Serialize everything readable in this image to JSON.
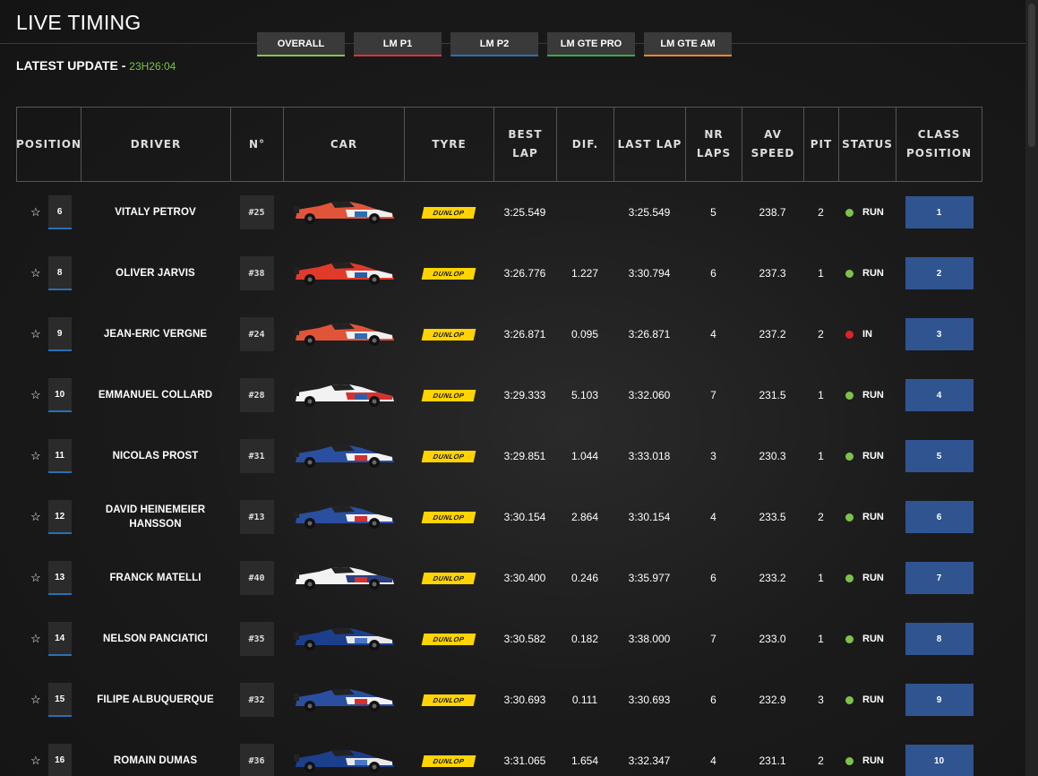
{
  "page": {
    "title": "LIVE TIMING",
    "update_label": "LATEST UPDATE - ",
    "update_time": "23H26:04"
  },
  "tabs": [
    {
      "label": "OVERALL",
      "color": "#8bc34a"
    },
    {
      "label": "LM P1",
      "color": "#e0323a"
    },
    {
      "label": "LM P2",
      "color": "#2a6fb4"
    },
    {
      "label": "LM GTE PRO",
      "color": "#39a84a"
    },
    {
      "label": "LM GTE AM",
      "color": "#f08a2c"
    }
  ],
  "columns": [
    "POSITION",
    "DRIVER",
    "N°",
    "CAR",
    "TYRE",
    "BEST\nLAP",
    "DIF.",
    "LAST LAP",
    "NR\nLAPS",
    "AV\nSPEED",
    "PIT",
    "STATUS",
    "CLASS\nPOSITION"
  ],
  "tyre_brand": "DUNLOP",
  "status_colors": {
    "RUN": "#7cc24a",
    "IN": "#e02424"
  },
  "rows": [
    {
      "position": "6",
      "driver": "VITALY PETROV",
      "number": "#25",
      "livery": [
        "#e0553a",
        "#f0f0f0",
        "#2a6fb4"
      ],
      "best_lap": "3:25.549",
      "dif": "",
      "last_lap": "3:25.549",
      "laps": "5",
      "speed": "238.7",
      "pit": "2",
      "status": "RUN",
      "class_pos": "1"
    },
    {
      "position": "8",
      "driver": "OLIVER JARVIS",
      "number": "#38",
      "livery": [
        "#e03a2a",
        "#f0f0f0",
        "#2a5ea8"
      ],
      "best_lap": "3:26.776",
      "dif": "1.227",
      "last_lap": "3:30.794",
      "laps": "6",
      "speed": "237.3",
      "pit": "1",
      "status": "RUN",
      "class_pos": "2"
    },
    {
      "position": "9",
      "driver": "JEAN-ERIC VERGNE",
      "number": "#24",
      "livery": [
        "#e0553a",
        "#f0f0f0",
        "#2a6fb4"
      ],
      "best_lap": "3:26.871",
      "dif": "0.095",
      "last_lap": "3:26.871",
      "laps": "4",
      "speed": "237.2",
      "pit": "2",
      "status": "IN",
      "class_pos": "3"
    },
    {
      "position": "10",
      "driver": "EMMANUEL COLLARD",
      "number": "#28",
      "livery": [
        "#f2f2f2",
        "#d83030",
        "#2a5ea8"
      ],
      "best_lap": "3:29.333",
      "dif": "5.103",
      "last_lap": "3:32.060",
      "laps": "7",
      "speed": "231.5",
      "pit": "1",
      "status": "RUN",
      "class_pos": "4"
    },
    {
      "position": "11",
      "driver": "NICOLAS PROST",
      "number": "#31",
      "livery": [
        "#2a4fa0",
        "#f2f2f2",
        "#d83030"
      ],
      "best_lap": "3:29.851",
      "dif": "1.044",
      "last_lap": "3:33.018",
      "laps": "3",
      "speed": "230.3",
      "pit": "1",
      "status": "RUN",
      "class_pos": "5"
    },
    {
      "position": "12",
      "driver": "DAVID HEINEMEIER HANSSON",
      "number": "#13",
      "livery": [
        "#2a4fa0",
        "#f2f2f2",
        "#d83030"
      ],
      "best_lap": "3:30.154",
      "dif": "2.864",
      "last_lap": "3:30.154",
      "laps": "4",
      "speed": "233.5",
      "pit": "2",
      "status": "RUN",
      "class_pos": "6"
    },
    {
      "position": "13",
      "driver": "FRANCK MATELLI",
      "number": "#40",
      "livery": [
        "#f2f2f2",
        "#2a3f80",
        "#d83030"
      ],
      "best_lap": "3:30.400",
      "dif": "0.246",
      "last_lap": "3:35.977",
      "laps": "6",
      "speed": "233.2",
      "pit": "1",
      "status": "RUN",
      "class_pos": "7"
    },
    {
      "position": "14",
      "driver": "NELSON PANCIATICI",
      "number": "#35",
      "livery": [
        "#1c3f8c",
        "#e8e8e8",
        "#4a78c8"
      ],
      "best_lap": "3:30.582",
      "dif": "0.182",
      "last_lap": "3:38.000",
      "laps": "7",
      "speed": "233.0",
      "pit": "1",
      "status": "RUN",
      "class_pos": "8"
    },
    {
      "position": "15",
      "driver": "FILIPE ALBUQUERQUE",
      "number": "#32",
      "livery": [
        "#2a4fa0",
        "#f2f2f2",
        "#d83030"
      ],
      "best_lap": "3:30.693",
      "dif": "0.111",
      "last_lap": "3:30.693",
      "laps": "6",
      "speed": "232.9",
      "pit": "3",
      "status": "RUN",
      "class_pos": "9"
    },
    {
      "position": "16",
      "driver": "ROMAIN DUMAS",
      "number": "#36",
      "livery": [
        "#1c3f8c",
        "#e8e8e8",
        "#4a78c8"
      ],
      "best_lap": "3:31.065",
      "dif": "1.654",
      "last_lap": "3:32.347",
      "laps": "4",
      "speed": "231.1",
      "pit": "2",
      "status": "RUN",
      "class_pos": "10"
    }
  ]
}
